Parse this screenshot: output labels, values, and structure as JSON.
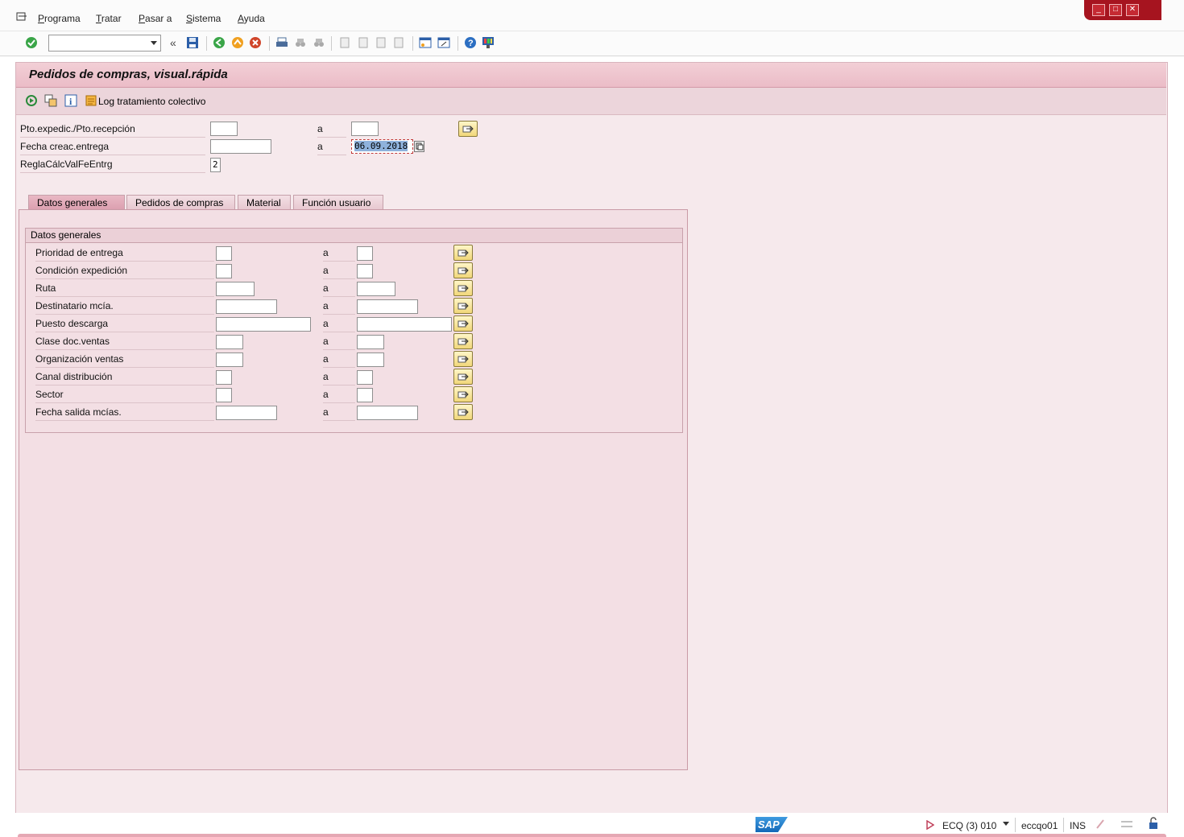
{
  "menu": [
    {
      "label": "Programa",
      "underline": "P",
      "rest": "rograma"
    },
    {
      "label": "Tratar",
      "underline": "T",
      "rest": "ratar"
    },
    {
      "label": "Pasar a",
      "underline": "P",
      "rest": "asar a"
    },
    {
      "label": "Sistema",
      "underline": "S",
      "rest": "istema"
    },
    {
      "label": "Ayuda",
      "underline": "A",
      "rest": "yuda"
    }
  ],
  "toolbar": {
    "command_field_value": "",
    "back_arrows": "«"
  },
  "page": {
    "title": "Pedidos de compras, visual.rápida"
  },
  "app_toolbar": {
    "log_label": "Log tratamiento colectivo"
  },
  "selection": {
    "to_label": "a",
    "rows": [
      {
        "label": "Pto.expedic./Pto.recepción",
        "from": "",
        "to": ""
      },
      {
        "label": "Fecha creac.entrega",
        "from": "",
        "to": "06.09.2018"
      },
      {
        "label": "ReglaCálcValFeEntrg",
        "from": "2"
      }
    ]
  },
  "tabs": [
    {
      "label": "Datos generales",
      "active": true
    },
    {
      "label": "Pedidos de compras",
      "active": false
    },
    {
      "label": "Material",
      "active": false
    },
    {
      "label": "Función usuario",
      "active": false
    }
  ],
  "group": {
    "title": "Datos generales",
    "to_label": "a",
    "rows": [
      {
        "label": "Prioridad de entrega",
        "from": "",
        "to": ""
      },
      {
        "label": "Condición expedición",
        "from": "",
        "to": ""
      },
      {
        "label": "Ruta",
        "from": "",
        "to": ""
      },
      {
        "label": "Destinatario mcía.",
        "from": "",
        "to": ""
      },
      {
        "label": "Puesto descarga",
        "from": "",
        "to": ""
      },
      {
        "label": "Clase doc.ventas",
        "from": "",
        "to": ""
      },
      {
        "label": "Organización ventas",
        "from": "",
        "to": ""
      },
      {
        "label": "Canal distribución",
        "from": "",
        "to": ""
      },
      {
        "label": "Sector",
        "from": "",
        "to": ""
      },
      {
        "label": "Fecha salida mcías.",
        "from": "",
        "to": ""
      }
    ]
  },
  "status": {
    "sap_logo": "SAP",
    "system": "ECQ (3) 010",
    "server": "eccqo01",
    "mode": "INS"
  },
  "colors": {
    "title_bg": "#ebbcc7",
    "panel_bg": "#f3dfe4",
    "window_close_red": "#a6141f"
  }
}
